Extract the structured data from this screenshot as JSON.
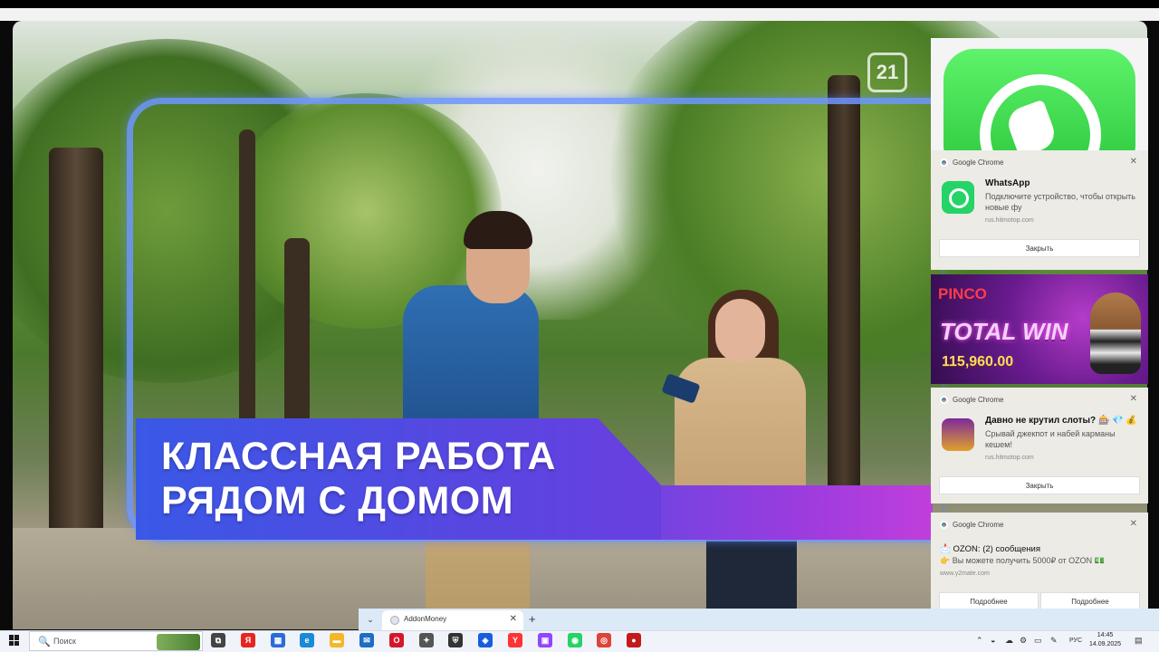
{
  "video": {
    "headline_line1": "КЛАССНАЯ РАБОТА",
    "headline_line2": "РЯДОМ С ДОМОМ",
    "channel_logo": "21",
    "colors": {
      "frame": "#6e96ff",
      "banner": "#3a58e6",
      "stripe_end": "#c13edb"
    }
  },
  "notifications": [
    {
      "source": "Google Chrome",
      "title": "WhatsApp",
      "text": "Подключите устройство, чтобы открыть новые фу",
      "site": "rus.hitmotop.com",
      "buttons": [
        "Закрыть"
      ],
      "icon": "whatsapp-icon"
    },
    {
      "source": "Google Chrome",
      "title": "Давно не крутил слоты? 🎰 💎 💰",
      "text": "Срывай джекпот и набей карманы кешем!",
      "site": "rus.hitmotop.com",
      "buttons": [
        "Закрыть"
      ],
      "icon": "slot-machine-icon"
    },
    {
      "source": "Google Chrome",
      "title": "📩 OZON: (2) сообщения",
      "text": "👉 Вы можете получить 5000₽ от OZON 💵",
      "site": "www.y2mate.com",
      "buttons": [
        "Подробнее",
        "Подробнее"
      ],
      "icon": "chrome-icon"
    }
  ],
  "pinco_ad": {
    "brand": "PINCO",
    "headline": "TOTAL WIN",
    "amount": "115,960.00"
  },
  "browser_tabs": [
    {
      "label": "AddonMoney",
      "close": "✕"
    }
  ],
  "new_tab": "+",
  "tab_dropdown": "⌄",
  "notif_close": "✕",
  "taskbar": {
    "search_placeholder": "Поиск",
    "search_icon": "🔍",
    "pinned": [
      {
        "name": "task-view-icon",
        "glyph": "⧉",
        "color": "#444444"
      },
      {
        "name": "yandex-icon",
        "glyph": "Я",
        "color": "#e52620"
      },
      {
        "name": "store-icon",
        "glyph": "▦",
        "color": "#2b6cd6"
      },
      {
        "name": "edge-icon",
        "glyph": "e",
        "color": "#1a8ad6"
      },
      {
        "name": "explorer-icon",
        "glyph": "▬",
        "color": "#f2b827"
      },
      {
        "name": "mail-icon",
        "glyph": "✉",
        "color": "#1d6ec2"
      },
      {
        "name": "opera-icon",
        "glyph": "O",
        "color": "#d4182c"
      },
      {
        "name": "app-icon",
        "glyph": "✦",
        "color": "#555555"
      },
      {
        "name": "shield-app-icon",
        "glyph": "⛨",
        "color": "#333333"
      },
      {
        "name": "bitwarden-icon",
        "glyph": "◈",
        "color": "#175ddc"
      },
      {
        "name": "yandex-browser-icon",
        "glyph": "Y",
        "color": "#ff3333"
      },
      {
        "name": "twitch-icon",
        "glyph": "▣",
        "color": "#9146ff"
      },
      {
        "name": "whatsapp-task-icon",
        "glyph": "◉",
        "color": "#25d366"
      },
      {
        "name": "chrome-task-icon",
        "glyph": "◎",
        "color": "#db4437"
      },
      {
        "name": "recorder-icon",
        "glyph": "●",
        "color": "#c41a1a"
      }
    ],
    "tray_chevron": "⌃",
    "language": "РУС",
    "time": "14:45",
    "date": "14.09.2025"
  }
}
